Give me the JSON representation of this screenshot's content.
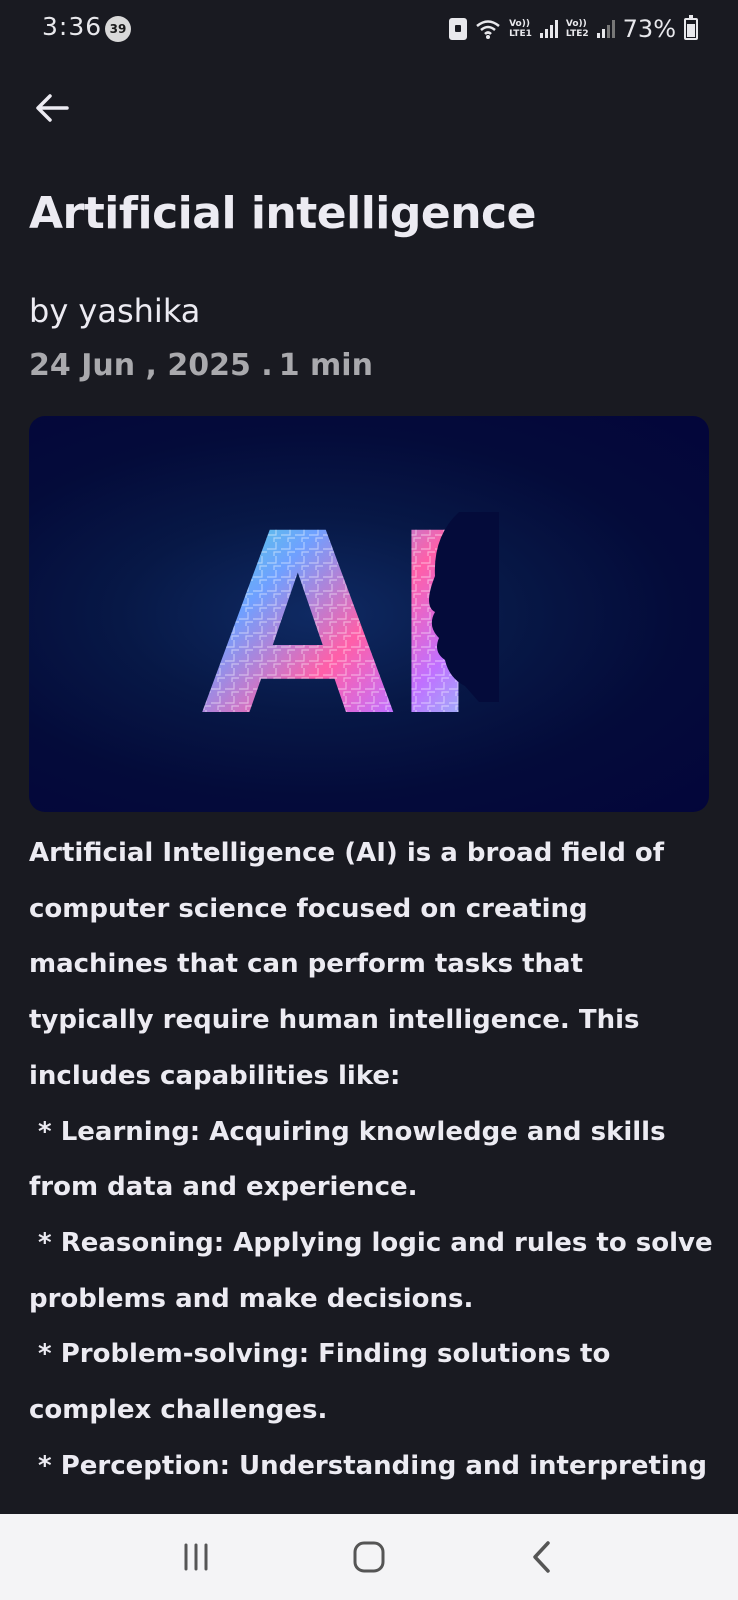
{
  "status_bar": {
    "time": "3:36",
    "notification_count": "39",
    "network_1": [
      "Vo))",
      "LTE1"
    ],
    "network_2": [
      "Vo))",
      "LTE2"
    ],
    "battery": "73%"
  },
  "article": {
    "title": "Artificial intelligence",
    "author": "by yashika",
    "date": "24 Jun , 2025 .",
    "read_time": "1 min",
    "hero_text": "AI",
    "body_lines": [
      "Artificial Intelligence (AI) is a broad field of",
      "computer science focused on creating",
      "machines that can perform tasks that",
      "typically require human intelligence. This",
      "includes capabilities like:",
      " * Learning: Acquiring knowledge and skills",
      "from data and experience.",
      " * Reasoning: Applying logic and rules to solve",
      "problems and make decisions.",
      " * Problem-solving: Finding solutions to",
      "complex challenges.",
      " * Perception: Understanding and interpreting"
    ]
  },
  "icons": {
    "back": "arrow-left-icon",
    "recents": "recent-apps-icon",
    "home": "home-icon",
    "nav_back": "chevron-left-icon"
  },
  "colors": {
    "background": "#191a21",
    "text": "#ecebf2",
    "meta": "#a9a9ad",
    "nav_bar": "#f4f4f6"
  }
}
